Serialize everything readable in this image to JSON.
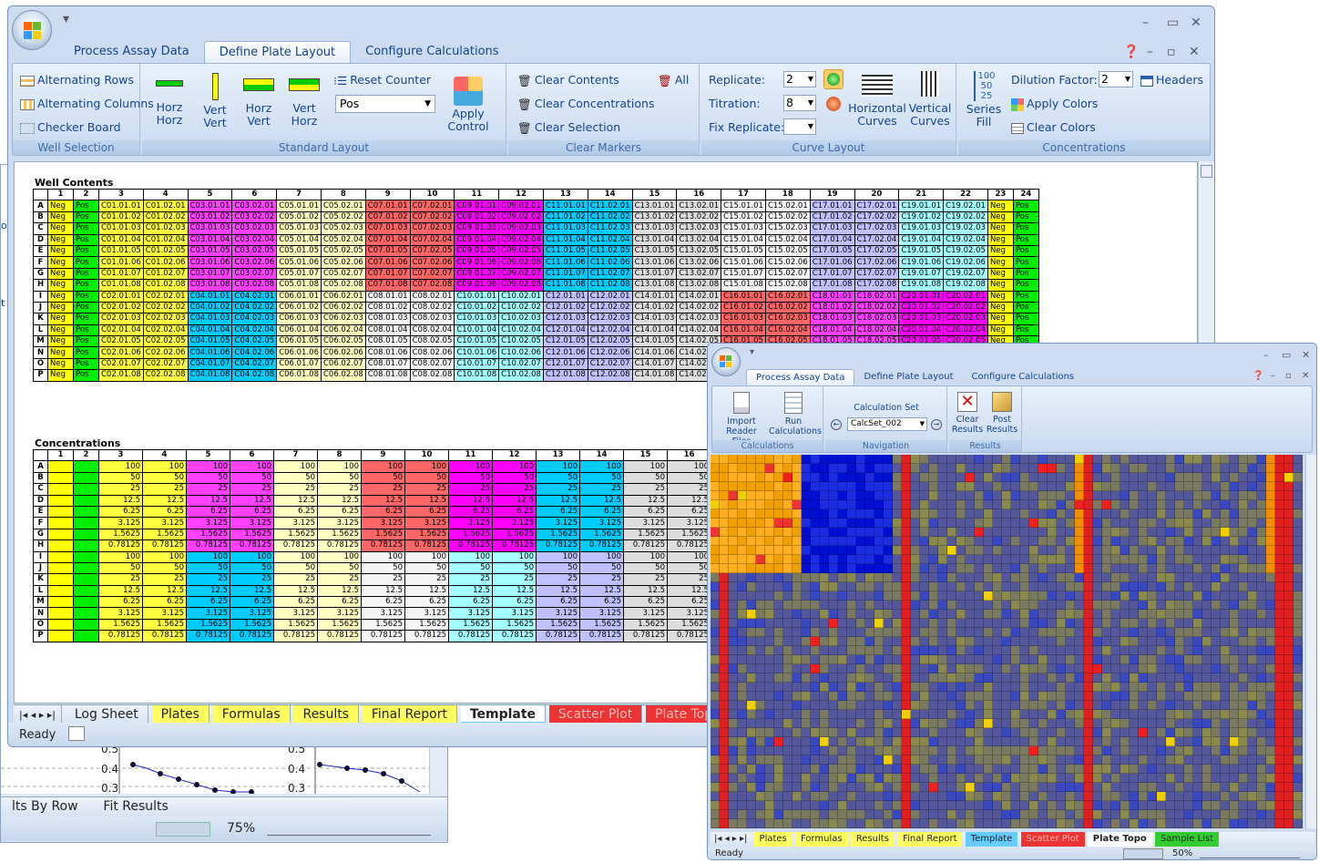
{
  "bg_window": {
    "axis_ticks_left": [
      "0.5",
      "0.4",
      "0.3"
    ],
    "axis_ticks_right": [
      "0.5",
      "0.4",
      "0.3"
    ],
    "left_edge_labels": [
      "o",
      "t"
    ],
    "sheet_tabs": [
      "lts By Row",
      "Fit Results"
    ],
    "zoom": "75%"
  },
  "main": {
    "tabs": [
      "Process Assay Data",
      "Define Plate Layout",
      "Configure Calculations"
    ],
    "active_tab": "Define Plate Layout",
    "groups": {
      "well_selection": {
        "label": "Well Selection",
        "items": [
          "Alternating Rows",
          "Alternating Columns",
          "Checker Board"
        ]
      },
      "standard_layout": {
        "label": "Standard Layout",
        "buttons": [
          "Horz Horz",
          "Vert Vert",
          "Horz Vert",
          "Vert Horz"
        ],
        "reset": "Reset Counter",
        "pos_value": "Pos",
        "apply": "Apply Control"
      },
      "clear_markers": {
        "label": "Clear Markers",
        "items": [
          "Clear Contents",
          "Clear Concentrations",
          "Clear Selection"
        ],
        "all": "All"
      },
      "curve_layout": {
        "label": "Curve Layout",
        "replicate_label": "Replicate:",
        "replicate_value": "2",
        "titration_label": "Titration:",
        "titration_value": "8",
        "fix_label": "Fix Replicate:",
        "fix_value": "",
        "horizontal": "Horizontal Curves",
        "vertical": "Vertical Curves"
      },
      "concentrations": {
        "label": "Concentrations",
        "series_fill": "Series Fill",
        "series_nums": [
          "100",
          "50",
          "25"
        ],
        "dilution_label": "Dilution Factor:",
        "dilution_value": "2",
        "headers": "Headers",
        "apply_colors": "Apply Colors",
        "clear_colors": "Clear Colors"
      }
    },
    "well_contents_title": "Well Contents",
    "concentrations_title": "Concentrations",
    "sheet_tabs": [
      "Log Sheet",
      "Plates",
      "Formulas",
      "Results",
      "Final Report",
      "Template",
      "Scatter Plot",
      "Plate Topo"
    ],
    "active_sheet": "Template",
    "status": "Ready"
  },
  "colors": {
    "neg": "#ffff00",
    "pos": "#00ee00",
    "c1": "#ffff40",
    "c2": "#ff40ff",
    "c3": "#ffffc0",
    "c4": "#ff6666",
    "c5": "#ff00ff",
    "c6": "#00ccff",
    "c7": "#dddddd",
    "c8": "#f5f5f5",
    "c9": "#c0c0ff",
    "c10": "#a5ffff"
  },
  "popup": {
    "tabs": [
      "Process Assay Data",
      "Define Plate Layout",
      "Configure Calculations"
    ],
    "active_tab": "Process Assay Data",
    "groups": {
      "calculations": {
        "label": "Calculations",
        "items": [
          "Import Reader Files",
          "Run Calculations"
        ]
      },
      "navigation": {
        "label": "Navigation",
        "title": "Calculation Set",
        "value": "CalcSet_002"
      },
      "results": {
        "label": "Results",
        "items": [
          "Clear Results",
          "Post Results"
        ]
      }
    },
    "sheet_tabs": [
      "Plates",
      "Formulas",
      "Results",
      "Final Report",
      "Template",
      "Scatter Plot",
      "Plate Topo",
      "Sample List"
    ],
    "active_sheet": "Plate Topo",
    "status": "Ready",
    "zoom": "50%"
  }
}
